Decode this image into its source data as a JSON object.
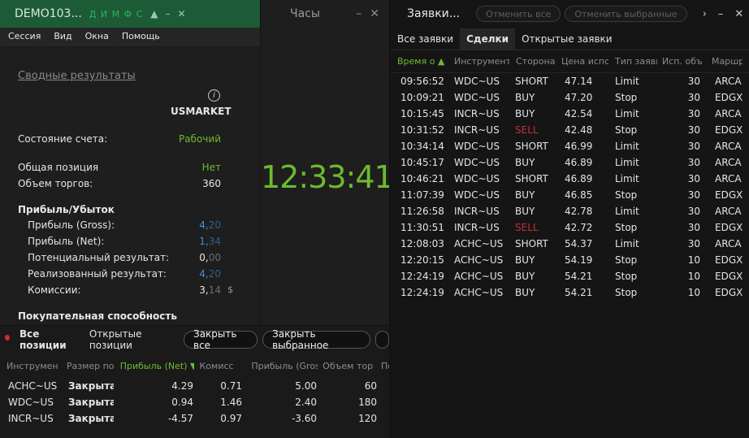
{
  "account": {
    "title": "DEMO103...",
    "title_letters": "Д И М Ф С",
    "menu": [
      "Сессия",
      "Вид",
      "Окна",
      "Помощь"
    ],
    "summary_link": "Сводные результаты",
    "market": "USMARKET",
    "status_label": "Состояние счета:",
    "status_value": "Рабочий",
    "position_label": "Общая позиция",
    "position_value": "Нет",
    "volume_label": "Объем торгов:",
    "volume_value": "360",
    "pnl_section": "Прибыль/Убыток",
    "gross_label": "Прибыль (Gross):",
    "gross_int": "4,",
    "gross_dec": "20",
    "net_label": "Прибыль (Net):",
    "net_int": "1,",
    "net_dec": "34",
    "potential_label": "Потенциальный результат:",
    "potential_int": "0,",
    "potential_dec": "00",
    "realized_label": "Реализованный результат:",
    "realized_int": "4,",
    "realized_dec": "20",
    "commission_label": "Комиссии:",
    "commission_int": "3,",
    "commission_dec": "14",
    "currency": "$",
    "buying_power": "Покупательная способность"
  },
  "clock": {
    "title": "Часы",
    "time": "12:33:41"
  },
  "orders": {
    "title": "Заявки...",
    "cancel_all": "Отменить все",
    "cancel_selected": "Отменить выбранные",
    "tabs": [
      "Все заявки",
      "Сделки",
      "Открытые заявки"
    ],
    "headers": [
      "Время о ▲",
      "Инструмент",
      "Сторона",
      "Цена испс",
      "Тип заявк",
      "Исп. объе",
      "Маршр"
    ],
    "rows": [
      {
        "time": "09:56:52",
        "inst": "WDC~US",
        "side": "SHORT",
        "price": "47.14",
        "type": "Limit",
        "qty": "30",
        "route": "ARCA"
      },
      {
        "time": "10:09:21",
        "inst": "WDC~US",
        "side": "BUY",
        "price": "47.20",
        "type": "Stop",
        "qty": "30",
        "route": "EDGX"
      },
      {
        "time": "10:15:45",
        "inst": "INCR~US",
        "side": "BUY",
        "price": "42.54",
        "type": "Limit",
        "qty": "30",
        "route": "ARCA"
      },
      {
        "time": "10:31:52",
        "inst": "INCR~US",
        "side": "SELL",
        "price": "42.48",
        "type": "Stop",
        "qty": "30",
        "route": "EDGX"
      },
      {
        "time": "10:34:14",
        "inst": "WDC~US",
        "side": "SHORT",
        "price": "46.99",
        "type": "Limit",
        "qty": "30",
        "route": "ARCA"
      },
      {
        "time": "10:45:17",
        "inst": "WDC~US",
        "side": "BUY",
        "price": "46.89",
        "type": "Limit",
        "qty": "30",
        "route": "ARCA"
      },
      {
        "time": "10:46:21",
        "inst": "WDC~US",
        "side": "SHORT",
        "price": "46.89",
        "type": "Limit",
        "qty": "30",
        "route": "ARCA"
      },
      {
        "time": "11:07:39",
        "inst": "WDC~US",
        "side": "BUY",
        "price": "46.85",
        "type": "Stop",
        "qty": "30",
        "route": "EDGX"
      },
      {
        "time": "11:26:58",
        "inst": "INCR~US",
        "side": "BUY",
        "price": "42.78",
        "type": "Limit",
        "qty": "30",
        "route": "ARCA"
      },
      {
        "time": "11:30:51",
        "inst": "INCR~US",
        "side": "SELL",
        "price": "42.72",
        "type": "Stop",
        "qty": "30",
        "route": "EDGX"
      },
      {
        "time": "12:08:03",
        "inst": "ACHC~US",
        "side": "SHORT",
        "price": "54.37",
        "type": "Limit",
        "qty": "30",
        "route": "ARCA"
      },
      {
        "time": "12:20:15",
        "inst": "ACHC~US",
        "side": "BUY",
        "price": "54.19",
        "type": "Stop",
        "qty": "10",
        "route": "EDGX"
      },
      {
        "time": "12:24:19",
        "inst": "ACHC~US",
        "side": "BUY",
        "price": "54.21",
        "type": "Stop",
        "qty": "10",
        "route": "EDGX"
      },
      {
        "time": "12:24:19",
        "inst": "ACHC~US",
        "side": "BUY",
        "price": "54.21",
        "type": "Stop",
        "qty": "10",
        "route": "EDGX"
      }
    ]
  },
  "positions": {
    "tabs": [
      "Все позиции",
      "Открытые позиции"
    ],
    "close_all": "Закрыть все",
    "close_selected": "Закрыть выбранное",
    "headers": [
      "Инструмен",
      "Размер по:",
      "Прибыль (Net) ▼",
      "Комисс",
      "Прибыль (Gros",
      "Объем тор",
      "По"
    ],
    "rows": [
      {
        "inst": "ACHC~US",
        "size": "Закрытая",
        "net": "4.29",
        "comm": "0.71",
        "gross": "5.00",
        "vol": "60"
      },
      {
        "inst": "WDC~US",
        "size": "Закрытая",
        "net": "0.94",
        "comm": "1.46",
        "gross": "2.40",
        "vol": "180"
      },
      {
        "inst": "INCR~US",
        "size": "Закрытая",
        "net": "-4.57",
        "comm": "0.97",
        "gross": "-3.60",
        "vol": "120"
      }
    ]
  },
  "colors": {
    "green": "#6dbb30",
    "buy": "#3a8fe0",
    "short": "#e0303a",
    "sell": "#c0303a",
    "negative": "#e0303a"
  }
}
